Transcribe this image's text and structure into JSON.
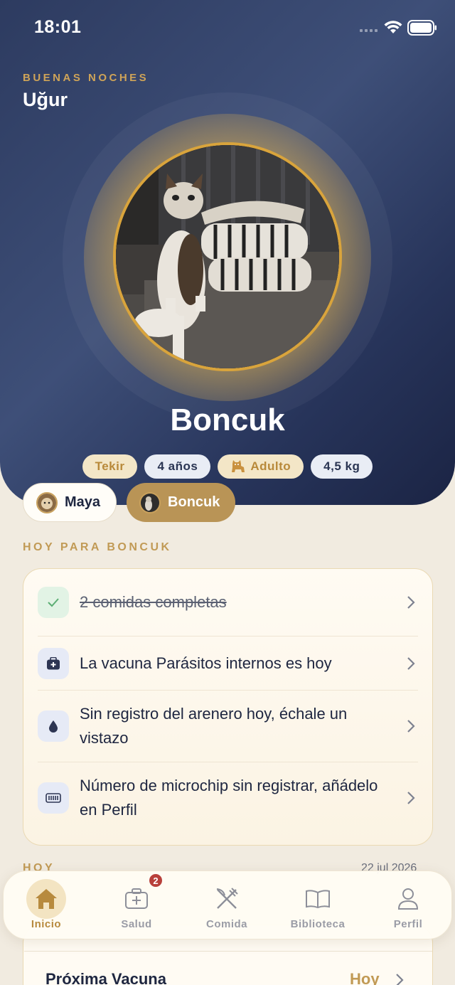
{
  "status_bar": {
    "time": "18:01"
  },
  "header": {
    "greeting": "BUENAS NOCHES",
    "user_name": "Uğur"
  },
  "pet": {
    "name": "Boncuk",
    "chips": {
      "breed": "Tekir",
      "age": "4 años",
      "stage": "Adulto",
      "weight": "4,5 kg"
    }
  },
  "pet_switcher": [
    {
      "name": "Maya",
      "active": false
    },
    {
      "name": "Boncuk",
      "active": true
    }
  ],
  "today": {
    "title": "HOY PARA BONCUK",
    "items": [
      {
        "icon": "check-icon",
        "text": "2 comidas completas",
        "done": true
      },
      {
        "icon": "medical-bag-icon",
        "text": "La vacuna Parásitos internos es hoy",
        "done": false
      },
      {
        "icon": "drop-icon",
        "text": "Sin registro del arenero hoy, échale un vistazo",
        "done": false
      },
      {
        "icon": "microchip-icon",
        "text": "Número de microchip sin registrar, añádelo en Perfil",
        "done": false
      }
    ]
  },
  "timeline": {
    "label": "HOY",
    "date": "22 jul 2026"
  },
  "next_vaccine": {
    "title": "Próxima Vacuna",
    "when": "Hoy"
  },
  "tab_bar": {
    "tabs": [
      {
        "label": "Inicio",
        "icon": "home-icon",
        "active": true
      },
      {
        "label": "Salud",
        "icon": "medical-kit-icon",
        "active": false,
        "badge": "2"
      },
      {
        "label": "Comida",
        "icon": "fork-knife-icon",
        "active": false
      },
      {
        "label": "Biblioteca",
        "icon": "book-icon",
        "active": false
      },
      {
        "label": "Perfil",
        "icon": "person-icon",
        "active": false
      }
    ]
  },
  "colors": {
    "hero": "#2d3b60",
    "gold": "#c19a55",
    "background": "#f1ebe0",
    "badge": "#b8403a"
  }
}
